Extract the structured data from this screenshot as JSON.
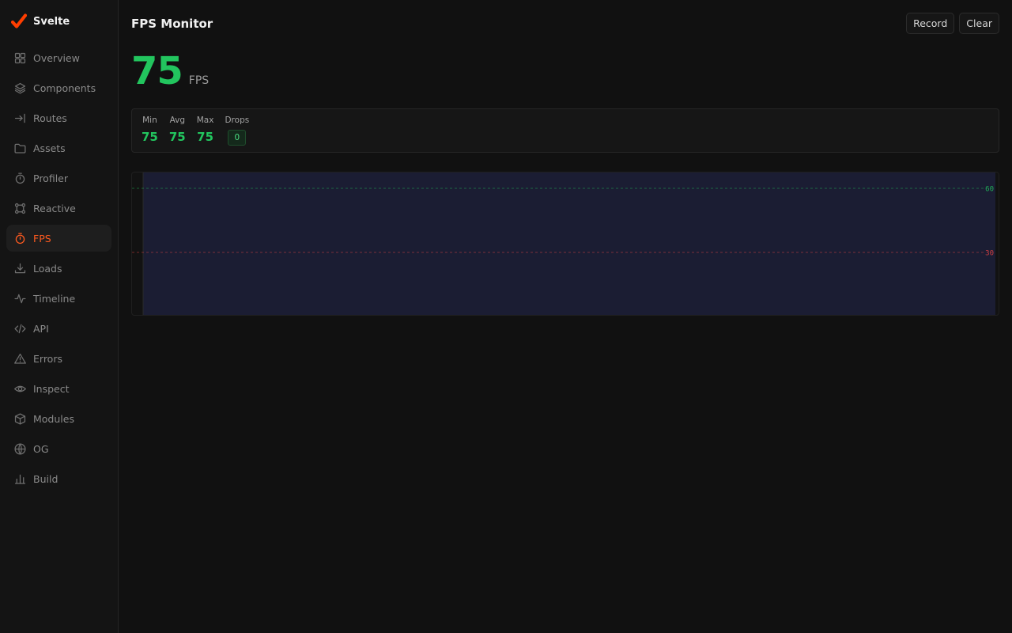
{
  "brand": {
    "name": "Svelte",
    "accent": "#ff3e00"
  },
  "sidebar": {
    "items": [
      {
        "label": "Overview",
        "icon": "grid-icon",
        "active": false
      },
      {
        "label": "Components",
        "icon": "layers-icon",
        "active": false
      },
      {
        "label": "Routes",
        "icon": "route-arrow-icon",
        "active": false
      },
      {
        "label": "Assets",
        "icon": "folder-icon",
        "active": false
      },
      {
        "label": "Profiler",
        "icon": "stopwatch-icon",
        "active": false
      },
      {
        "label": "Reactive",
        "icon": "nodes-icon",
        "active": false
      },
      {
        "label": "FPS",
        "icon": "timer-icon",
        "active": true
      },
      {
        "label": "Loads",
        "icon": "download-icon",
        "active": false
      },
      {
        "label": "Timeline",
        "icon": "activity-icon",
        "active": false
      },
      {
        "label": "API",
        "icon": "code-icon",
        "active": false
      },
      {
        "label": "Errors",
        "icon": "warning-icon",
        "active": false
      },
      {
        "label": "Inspect",
        "icon": "eye-icon",
        "active": false
      },
      {
        "label": "Modules",
        "icon": "package-icon",
        "active": false
      },
      {
        "label": "OG",
        "icon": "globe-icon",
        "active": false
      },
      {
        "label": "Build",
        "icon": "bar-chart-icon",
        "active": false
      }
    ]
  },
  "header": {
    "title": "FPS Monitor",
    "record_label": "Record",
    "clear_label": "Clear"
  },
  "fps": {
    "current": "75",
    "unit": "FPS",
    "stats": {
      "min_label": "Min",
      "min": "75",
      "avg_label": "Avg",
      "avg": "75",
      "max_label": "Max",
      "max": "75",
      "drops_label": "Drops",
      "drops": "0"
    }
  },
  "chart_data": {
    "type": "area",
    "values": [
      75,
      75
    ],
    "ylim": [
      0,
      100
    ],
    "thresholds": [
      {
        "value": 60,
        "label": "60",
        "color": "#22c55e"
      },
      {
        "value": 30,
        "label": "30",
        "color": "#ef4444"
      }
    ],
    "line_color": "#ff6a2b",
    "fill_color": "#1b1d33",
    "grid": false
  }
}
